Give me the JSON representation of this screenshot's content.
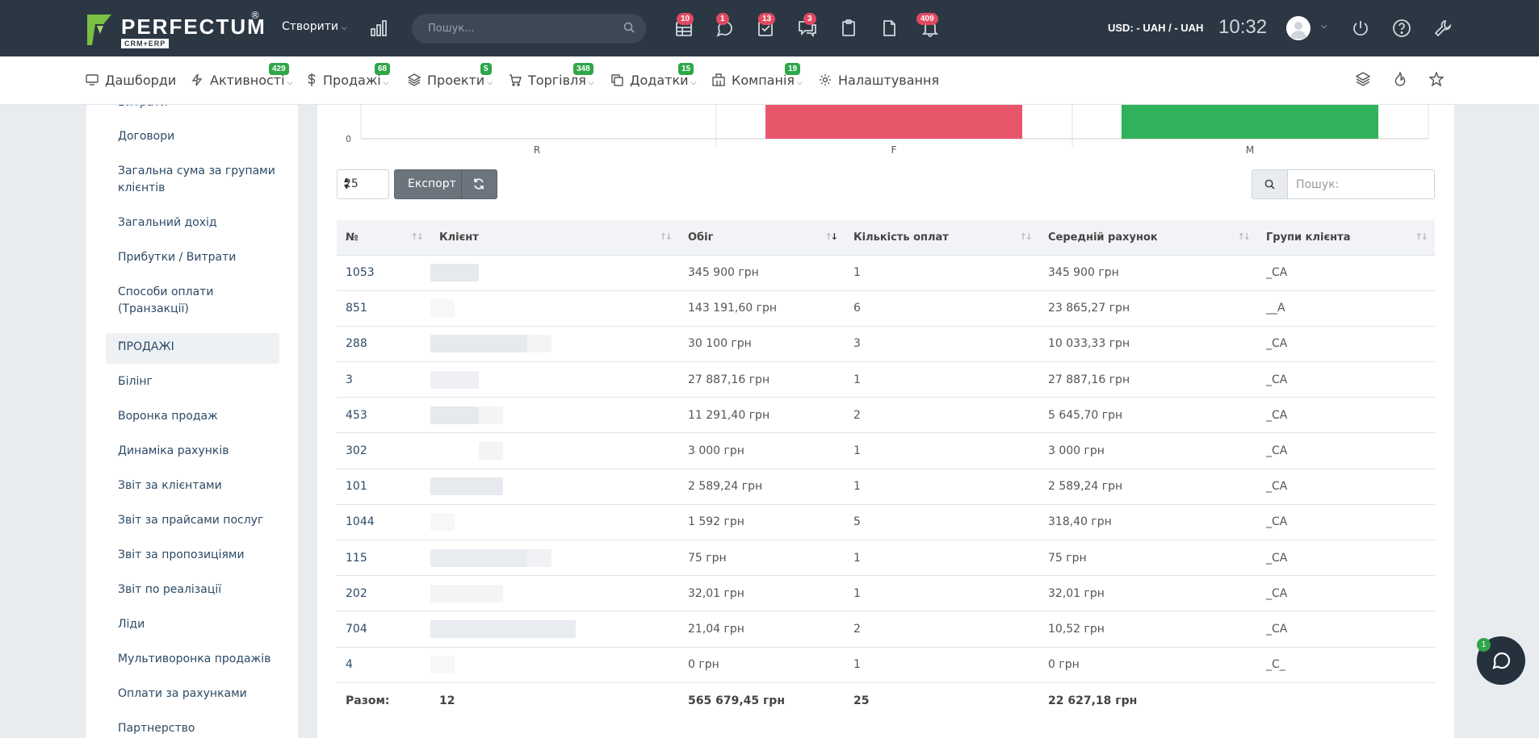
{
  "header": {
    "logo_text": "PERFECTUM",
    "logo_sub": "CRM+ERP",
    "logo_reg": "®",
    "create_label": "Створити",
    "search_placeholder": "Пошук...",
    "icons": [
      {
        "name": "tasks-table-icon",
        "badge": "10"
      },
      {
        "name": "chat-bubble-icon",
        "badge": "1"
      },
      {
        "name": "checklist-icon",
        "badge": "13"
      },
      {
        "name": "messages-icon",
        "badge": "3"
      },
      {
        "name": "clipboard-icon",
        "badge": ""
      },
      {
        "name": "document-icon",
        "badge": ""
      },
      {
        "name": "bell-icon",
        "badge": "409"
      }
    ],
    "currency": "USD: - UAH / - UAH",
    "time": "10:32"
  },
  "menu": {
    "items": [
      {
        "label": "Дашборди",
        "badge": ""
      },
      {
        "label": "Активності",
        "badge": "429"
      },
      {
        "label": "Продажі",
        "badge": "68"
      },
      {
        "label": "Проекти",
        "badge": "5"
      },
      {
        "label": "Торгівля",
        "badge": "348"
      },
      {
        "label": "Додатки",
        "badge": "15"
      },
      {
        "label": "Компанія",
        "badge": "19"
      },
      {
        "label": "Налаштування",
        "badge": ""
      }
    ]
  },
  "sidebar": {
    "items_top": [
      "Витрати",
      "Договори",
      "Загальна сума за групами клієнтів",
      "Загальний дохід",
      "Прибутки / Витрати",
      "Способи оплати (Транзакції)"
    ],
    "section": "ПРОДАЖІ",
    "items_sales": [
      "Білінг",
      "Воронка продаж",
      "Динаміка рахунків",
      "Звіт за клієнтами",
      "Звіт за прайсами послуг",
      "Звіт за пропозиціями",
      "Звіт по реалізації",
      "Ліди",
      "Мультиворонка продажів",
      "Оплати за рахунками",
      "Партнерство"
    ]
  },
  "chart_data": {
    "type": "bar",
    "categories": [
      "R",
      "F",
      "M"
    ],
    "y_tick": "0",
    "colors": [
      "#e8566c",
      "#e8566c",
      "#2fb25a"
    ],
    "note_visible": "bars partially visible (top cropped)"
  },
  "controls": {
    "page_size": "25",
    "export_label": "Експорт",
    "search_placeholder": "Пошук:"
  },
  "table": {
    "columns": [
      "№",
      "Клієнт",
      "Обіг",
      "Кількість оплат",
      "Середній рахунок",
      "Групи клієнта"
    ],
    "rows": [
      {
        "id": "1053",
        "turnover": "345 900 грн",
        "payments": "1",
        "avg": "345 900 грн",
        "group": "_CA"
      },
      {
        "id": "851",
        "turnover": "143 191,60 грн",
        "payments": "6",
        "avg": "23 865,27 грн",
        "group": "__A"
      },
      {
        "id": "288",
        "turnover": "30 100 грн",
        "payments": "3",
        "avg": "10 033,33 грн",
        "group": "_CA"
      },
      {
        "id": "3",
        "turnover": "27 887,16 грн",
        "payments": "1",
        "avg": "27 887,16 грн",
        "group": "_CA"
      },
      {
        "id": "453",
        "turnover": "11 291,40 грн",
        "payments": "2",
        "avg": "5 645,70 грн",
        "group": "_CA"
      },
      {
        "id": "302",
        "turnover": "3 000 грн",
        "payments": "1",
        "avg": "3 000 грн",
        "group": "_CA"
      },
      {
        "id": "101",
        "turnover": "2 589,24 грн",
        "payments": "1",
        "avg": "2 589,24 грн",
        "group": "_CA"
      },
      {
        "id": "1044",
        "turnover": "1 592 грн",
        "payments": "5",
        "avg": "318,40 грн",
        "group": "_CA"
      },
      {
        "id": "115",
        "turnover": "75 грн",
        "payments": "1",
        "avg": "75 грн",
        "group": "_CA"
      },
      {
        "id": "202",
        "turnover": "32,01 грн",
        "payments": "1",
        "avg": "32,01 грн",
        "group": "_CA"
      },
      {
        "id": "704",
        "turnover": "21,04 грн",
        "payments": "2",
        "avg": "10,52 грн",
        "group": "_CA"
      },
      {
        "id": "4",
        "turnover": "0 грн",
        "payments": "1",
        "avg": "0 грн",
        "group": "_C_"
      }
    ],
    "total": {
      "label": "Разом:",
      "clients": "12",
      "turnover": "565 679,45 грн",
      "payments": "25",
      "avg": "22 627,18 грн"
    }
  },
  "chat": {
    "badge": "1"
  }
}
